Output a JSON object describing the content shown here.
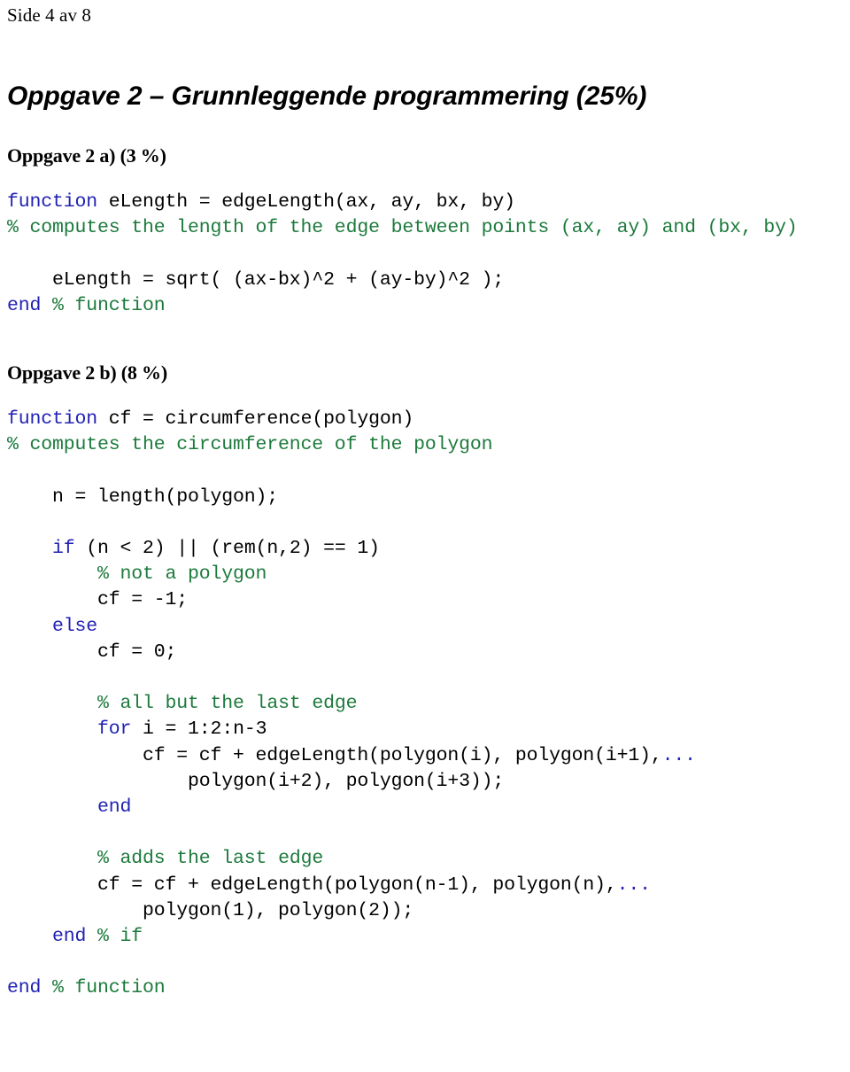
{
  "header": {
    "page_indicator": "Side 4 av 8"
  },
  "title": "Oppgave 2 – Grunnleggende programmering (25%)",
  "sections": [
    {
      "heading": "Oppgave 2 a) (3 %)",
      "code_lines": [
        [
          {
            "t": "function",
            "c": "kw"
          },
          {
            "t": " eLength = edgeLength(ax, ay, bx, by)",
            "c": "plain"
          }
        ],
        [
          {
            "t": "% computes the length of the edge between points (ax, ay) and (bx, by)",
            "c": "cmt"
          }
        ],
        [],
        [
          {
            "t": "    eLength = sqrt( (ax-bx)^2 + (ay-by)^2 );",
            "c": "plain"
          }
        ],
        [
          {
            "t": "end",
            "c": "kw"
          },
          {
            "t": " ",
            "c": "plain"
          },
          {
            "t": "% function",
            "c": "cmt"
          }
        ]
      ]
    },
    {
      "heading": "Oppgave 2 b) (8 %)",
      "code_lines": [
        [
          {
            "t": "function",
            "c": "kw"
          },
          {
            "t": " cf = circumference(polygon)",
            "c": "plain"
          }
        ],
        [
          {
            "t": "% computes the circumference of the polygon",
            "c": "cmt"
          }
        ],
        [],
        [
          {
            "t": "    n = length(polygon);",
            "c": "plain"
          }
        ],
        [],
        [
          {
            "t": "    ",
            "c": "plain"
          },
          {
            "t": "if",
            "c": "kw"
          },
          {
            "t": " (n < 2) || (rem(n,2) == 1)",
            "c": "plain"
          }
        ],
        [
          {
            "t": "        ",
            "c": "plain"
          },
          {
            "t": "% not a polygon",
            "c": "cmt"
          }
        ],
        [
          {
            "t": "        cf = -1;",
            "c": "plain"
          }
        ],
        [
          {
            "t": "    ",
            "c": "plain"
          },
          {
            "t": "else",
            "c": "kw"
          }
        ],
        [
          {
            "t": "        cf = 0;",
            "c": "plain"
          }
        ],
        [],
        [
          {
            "t": "        ",
            "c": "plain"
          },
          {
            "t": "% all but the last edge",
            "c": "cmt"
          }
        ],
        [
          {
            "t": "        ",
            "c": "plain"
          },
          {
            "t": "for",
            "c": "kw"
          },
          {
            "t": " i = 1:2:n-3",
            "c": "plain"
          }
        ],
        [
          {
            "t": "            cf = cf + edgeLength(polygon(i), polygon(i+1),",
            "c": "plain"
          },
          {
            "t": "...",
            "c": "cont"
          }
        ],
        [
          {
            "t": "                polygon(i+2), polygon(i+3));",
            "c": "plain"
          }
        ],
        [
          {
            "t": "        ",
            "c": "plain"
          },
          {
            "t": "end",
            "c": "kw"
          }
        ],
        [],
        [
          {
            "t": "        ",
            "c": "plain"
          },
          {
            "t": "% adds the last edge",
            "c": "cmt"
          }
        ],
        [
          {
            "t": "        cf = cf + edgeLength(polygon(n-1), polygon(n),",
            "c": "plain"
          },
          {
            "t": "...",
            "c": "cont"
          }
        ],
        [
          {
            "t": "            polygon(1), polygon(2));",
            "c": "plain"
          }
        ],
        [
          {
            "t": "    ",
            "c": "plain"
          },
          {
            "t": "end",
            "c": "kw"
          },
          {
            "t": " ",
            "c": "plain"
          },
          {
            "t": "% if",
            "c": "cmt"
          }
        ],
        [],
        [
          {
            "t": "end",
            "c": "kw"
          },
          {
            "t": " ",
            "c": "plain"
          },
          {
            "t": "% function",
            "c": "cmt"
          }
        ]
      ]
    }
  ],
  "colors": {
    "keyword_blue": "#2222b4",
    "comment_green": "#1c7a3c",
    "code_black": "#000000",
    "background": "#ffffff"
  }
}
